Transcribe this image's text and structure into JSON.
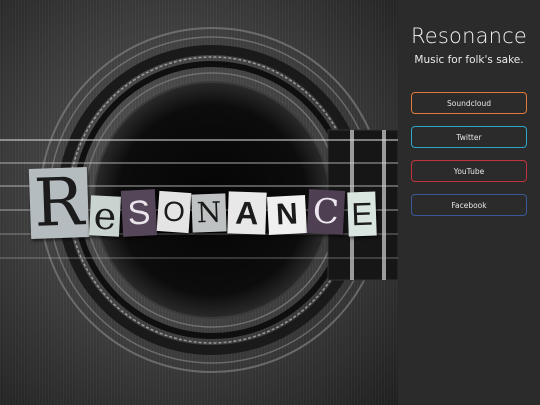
{
  "hero": {
    "logo_word": "RESONANCE",
    "logo_letters": [
      "R",
      "e",
      "S",
      "O",
      "N",
      "A",
      "N",
      "C",
      "E"
    ]
  },
  "sidebar": {
    "title": "Resonance",
    "tagline": "Music for folk's sake.",
    "links": [
      {
        "label": "Soundcloud",
        "color": "#e07a3a"
      },
      {
        "label": "Twitter",
        "color": "#2fa3c8"
      },
      {
        "label": "YouTube",
        "color": "#c0343d"
      },
      {
        "label": "Facebook",
        "color": "#3b5998"
      }
    ]
  }
}
